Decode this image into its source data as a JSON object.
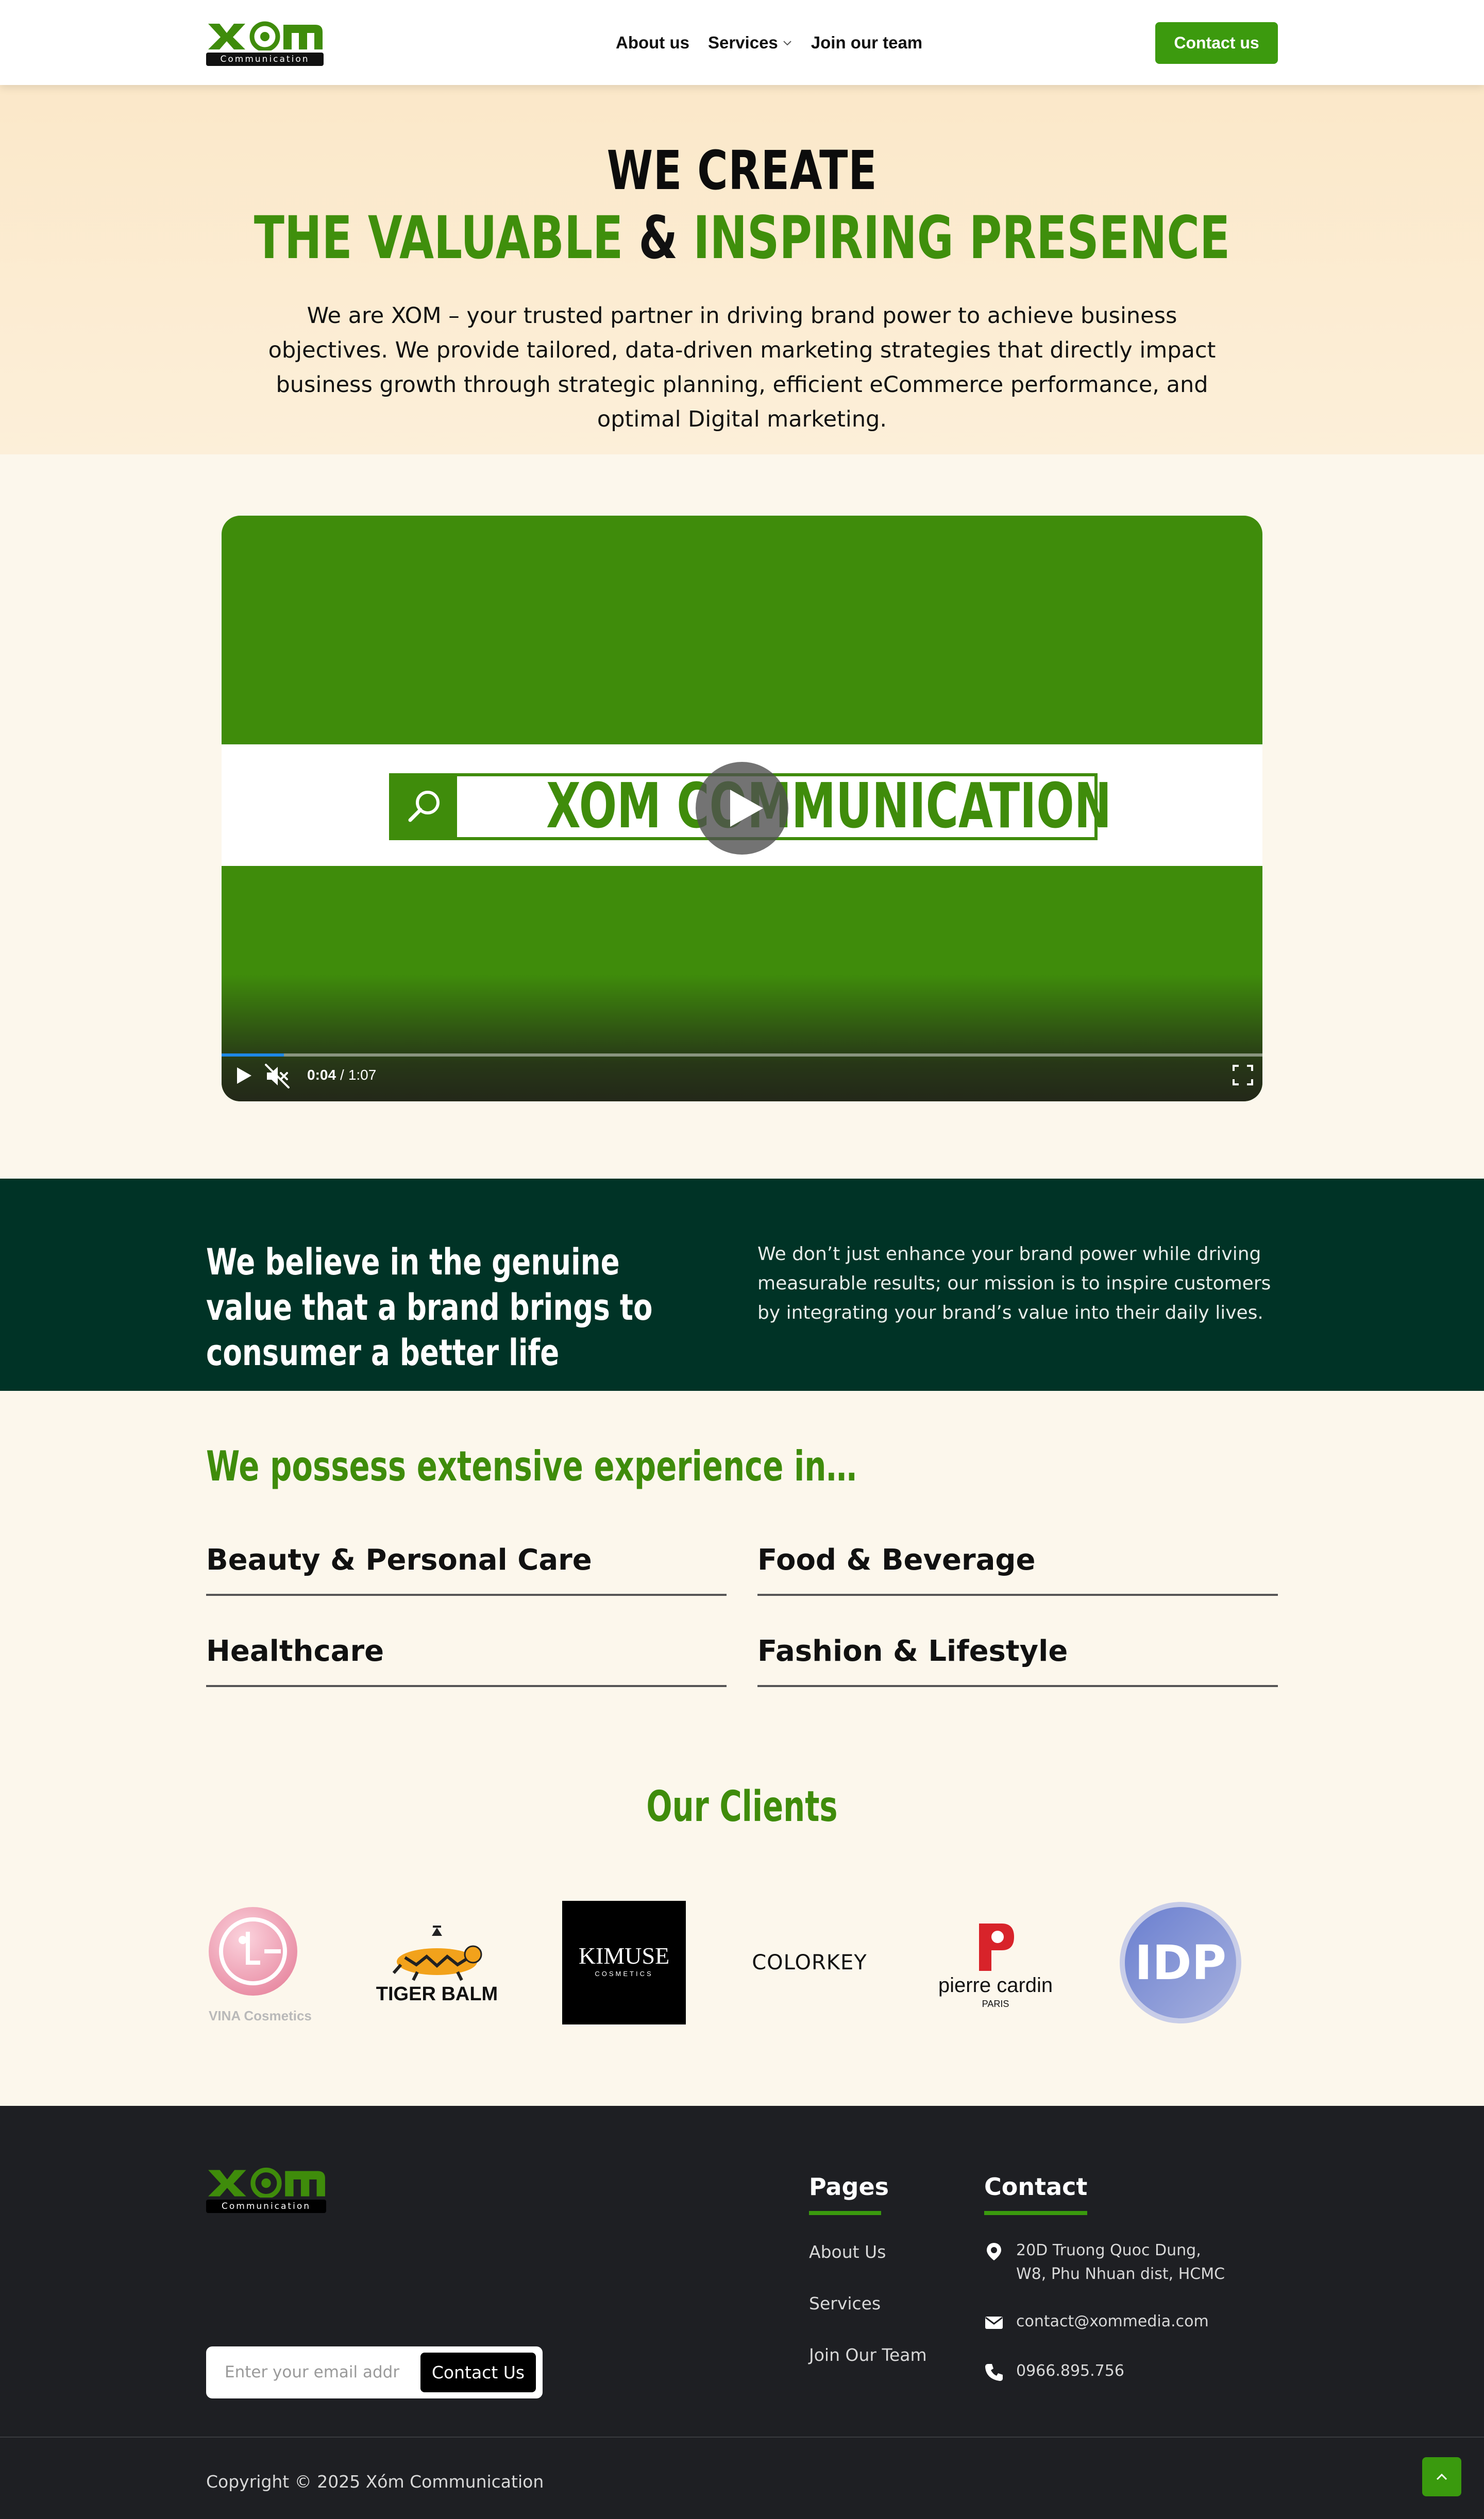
{
  "header": {
    "logo_tag": "Communication",
    "nav": [
      {
        "label": "About us"
      },
      {
        "label": "Services"
      },
      {
        "label": "Join our team"
      }
    ],
    "contact_button": "Contact us"
  },
  "hero": {
    "line1": "WE CREATE",
    "line2_part1": "THE VALUABLE",
    "line2_amp": "&",
    "line2_part2": "INSPIRING PRESENCE",
    "description": "We are XOM – your trusted partner in driving brand power to achieve business objectives. We provide tailored, data-driven marketing strategies that directly impact business growth through strategic planning, efficient eCommerce performance, and optimal Digital marketing."
  },
  "video": {
    "title": "XOM COMMUNICATION",
    "current_time": "0:04",
    "separator": "/",
    "duration": "1:07",
    "progress": 0.06
  },
  "mission": {
    "title": "We believe in the genuine value that a brand brings to consumer a better life",
    "text": "We don’t just enhance your brand power while driving measurable results; our mission is to inspire customers by integrating your brand’s value into their daily lives."
  },
  "experience": {
    "title": "We possess extensive experience in…",
    "items": [
      "Beauty & Personal Care",
      "Food & Beverage",
      "Healthcare",
      "Fashion & Lifestyle"
    ]
  },
  "clients": {
    "title": "Our Clients",
    "logos": [
      {
        "name": "LG VINA Cosmetics",
        "text": "VINA Cosmetics"
      },
      {
        "name": "Tiger Balm",
        "text": "TIGER BALM"
      },
      {
        "name": "Kimuse Cosmetics",
        "text": "KIMUSE",
        "sub": "COSMETICS"
      },
      {
        "name": "Colorkey",
        "text": "COLORKEY"
      },
      {
        "name": "Pierre Cardin Paris",
        "text": "pierre cardin",
        "sub": "PARIS"
      },
      {
        "name": "IDP",
        "text": "IDP"
      }
    ]
  },
  "footer": {
    "logo_tag": "Communication",
    "newsletter": {
      "placeholder": "Enter your email address",
      "button": "Contact Us"
    },
    "pages_title": "Pages",
    "pages": [
      "About Us",
      "Services",
      "Join Our Team"
    ],
    "contact_title": "Contact",
    "address_line1": "20D Truong Quoc Dung,",
    "address_line2": "W8, Phu Nhuan dist, HCMC",
    "email": "contact@xommedia.com",
    "phone": "0966.895.756",
    "copyright": "Copyright © 2025 Xóm Communication"
  },
  "colors": {
    "brand_green": "#3f8c0b",
    "button_green": "#3c9a0e",
    "mission_bg": "#003326",
    "footer_bg": "#1e1f23",
    "hero_bg": "#fbe8c9"
  }
}
